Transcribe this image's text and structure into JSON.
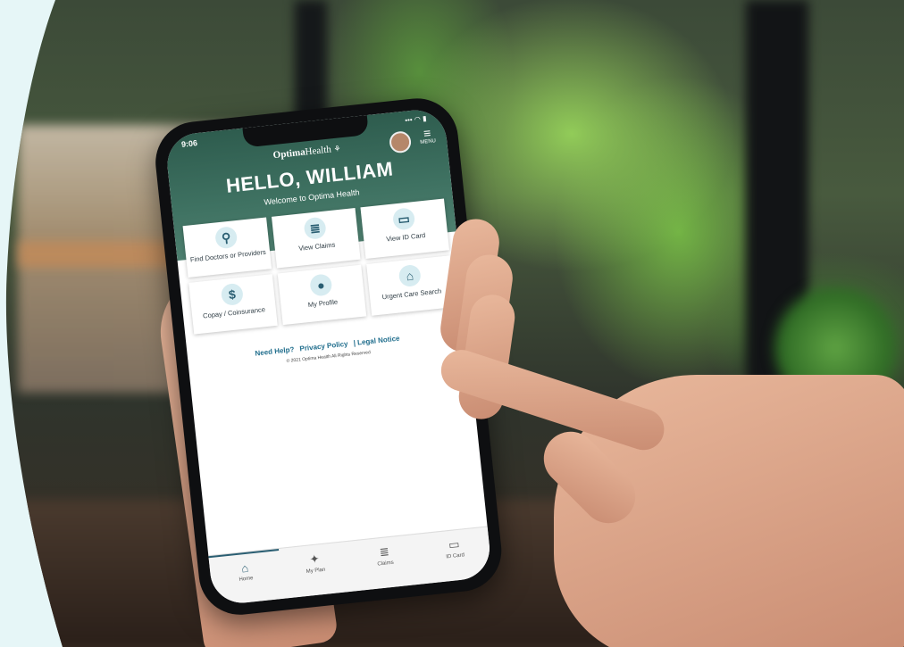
{
  "phone": {
    "status_time": "9:06",
    "status_icons": "••• ◠ ▮",
    "brand_bold": "Optima",
    "brand_light": "Health",
    "menu_label": "MENU",
    "greeting": "HELLO, WILLIAM",
    "welcome": "Welcome to Optima Health",
    "tiles": [
      {
        "label": "Find Doctors or Providers",
        "icon": "search-icon",
        "glyph": "⚲"
      },
      {
        "label": "View Claims",
        "icon": "document-icon",
        "glyph": "≣"
      },
      {
        "label": "View ID Card",
        "icon": "id-card-icon",
        "glyph": "▭"
      },
      {
        "label": "Copay / Coinsurance",
        "icon": "dollar-icon",
        "glyph": "$"
      },
      {
        "label": "My Profile",
        "icon": "person-icon",
        "glyph": "●"
      },
      {
        "label": "Urgent Care Search",
        "icon": "clinic-icon",
        "glyph": "⌂"
      }
    ],
    "links": {
      "help": "Need Help?",
      "privacy": "Privacy Policy",
      "legal": "| Legal Notice"
    },
    "copyright": "© 2021 Optima Health All Rights Reserved",
    "tabs": [
      {
        "label": "Home",
        "icon": "home-icon",
        "glyph": "⌂",
        "active": true
      },
      {
        "label": "My Plan",
        "icon": "plan-icon",
        "glyph": "✦",
        "active": false
      },
      {
        "label": "Claims",
        "icon": "claims-icon",
        "glyph": "≣",
        "active": false
      },
      {
        "label": "ID Card",
        "icon": "id-card-icon",
        "glyph": "▭",
        "active": false
      }
    ]
  },
  "colors": {
    "header": "#3f7262",
    "accent": "#2a5e72",
    "background": "#e6f6f7"
  }
}
